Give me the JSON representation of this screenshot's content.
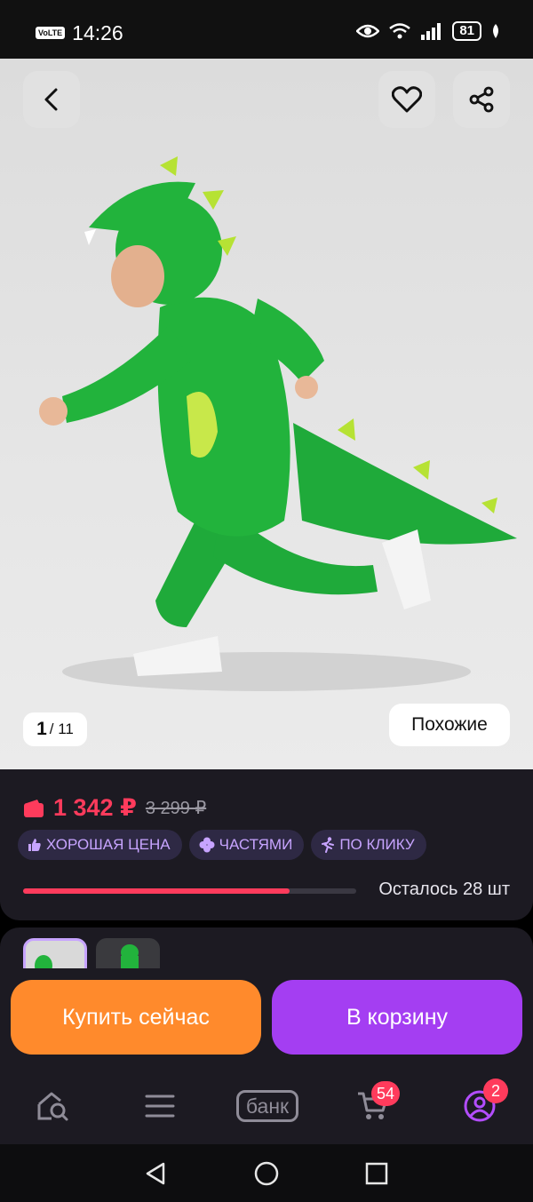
{
  "status_bar": {
    "network": "VoLTE",
    "time": "14:26",
    "battery": "81"
  },
  "gallery": {
    "current": "1",
    "total": "/ 11",
    "similar_label": "Похожие"
  },
  "price": {
    "current": "1 342 ₽",
    "old": "3 299 ₽"
  },
  "tags": [
    "ХОРОШАЯ ЦЕНА",
    "ЧАСТЯМИ",
    "ПО КЛИКУ"
  ],
  "stock": {
    "label": "Осталось 28 шт",
    "progress_fraction": 0.8
  },
  "actions": {
    "buy_now": "Купить сейчас",
    "add_to_cart": "В корзину"
  },
  "bottom_nav": {
    "bank_label": "банк",
    "cart_count": "54",
    "profile_count": "2"
  },
  "colors": {
    "accent_red": "#ff3b5c",
    "buy_orange": "#ff8a2c",
    "cart_purple": "#a43ef2",
    "panel_bg": "#1c1a22"
  }
}
